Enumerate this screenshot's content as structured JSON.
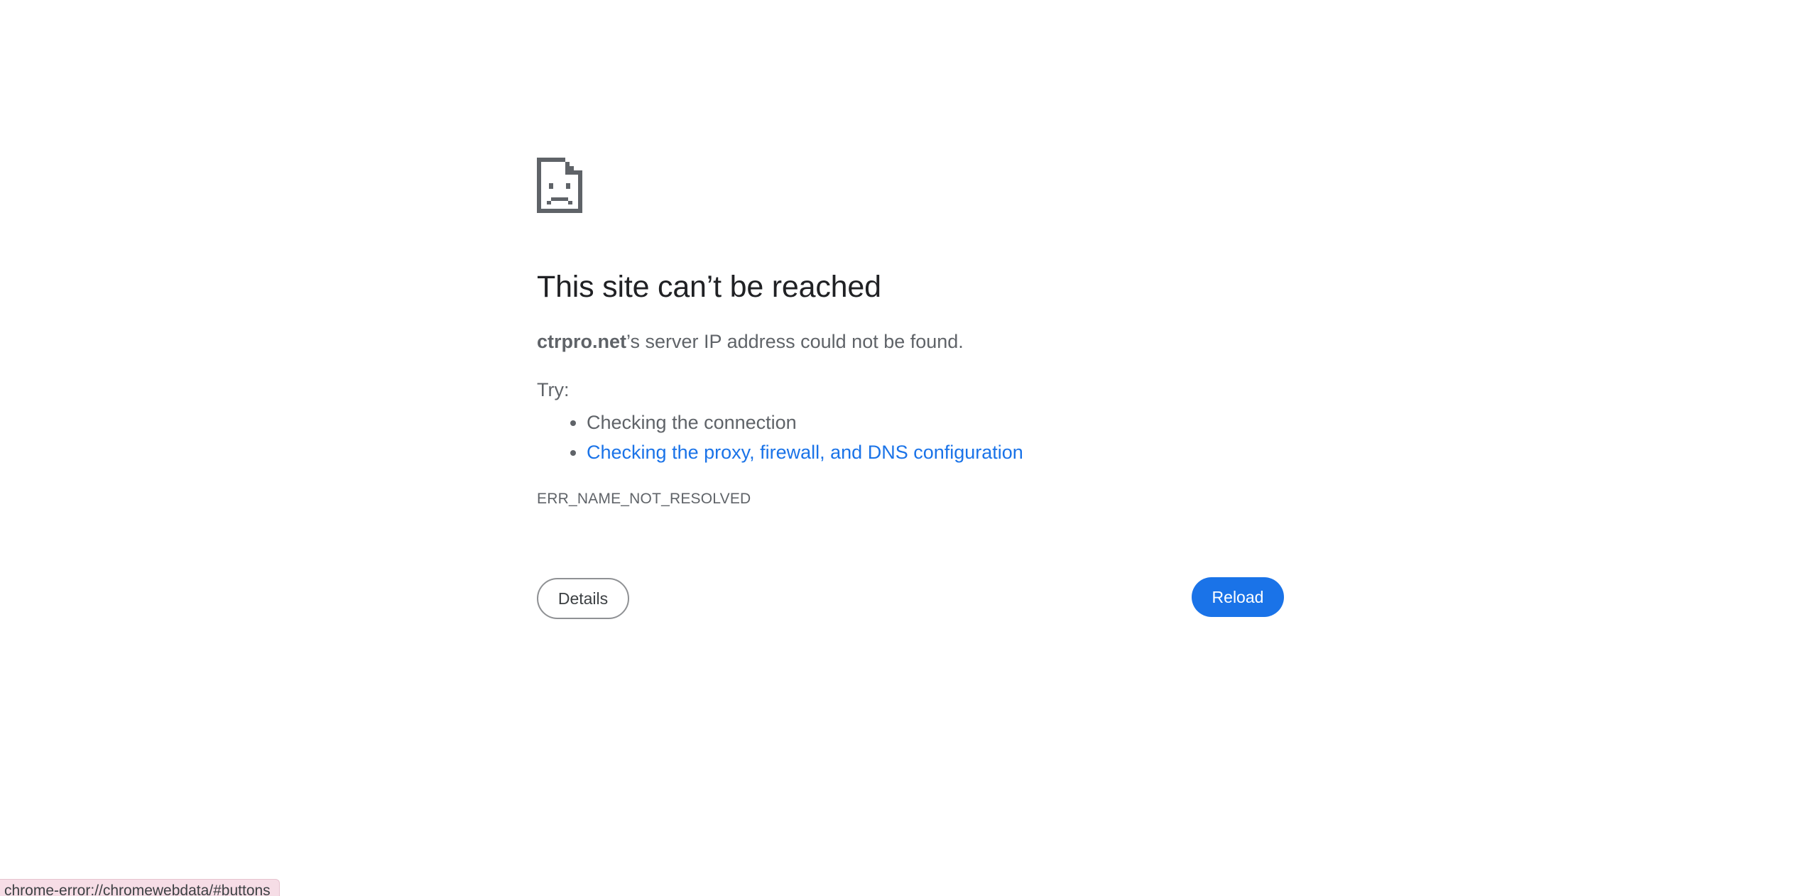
{
  "error_page": {
    "icon": "sad-page-icon",
    "heading": "This site can’t be reached",
    "summary": {
      "host": "ctrpro.net",
      "message": "’s server IP address could not be found."
    },
    "try_label": "Try:",
    "suggestions": [
      {
        "label": "Checking the connection",
        "is_link": false
      },
      {
        "label": "Checking the proxy, firewall, and DNS configuration",
        "is_link": true
      }
    ],
    "error_code": "ERR_NAME_NOT_RESOLVED",
    "buttons": {
      "details_label": "Details",
      "reload_label": "Reload"
    }
  },
  "status_bar": {
    "url": "chrome-error://chromewebdata/#buttons"
  },
  "colors": {
    "link": "#1a73e8",
    "primary_button": "#1a73e8",
    "heading": "#202124",
    "body_text": "#5f6368"
  }
}
